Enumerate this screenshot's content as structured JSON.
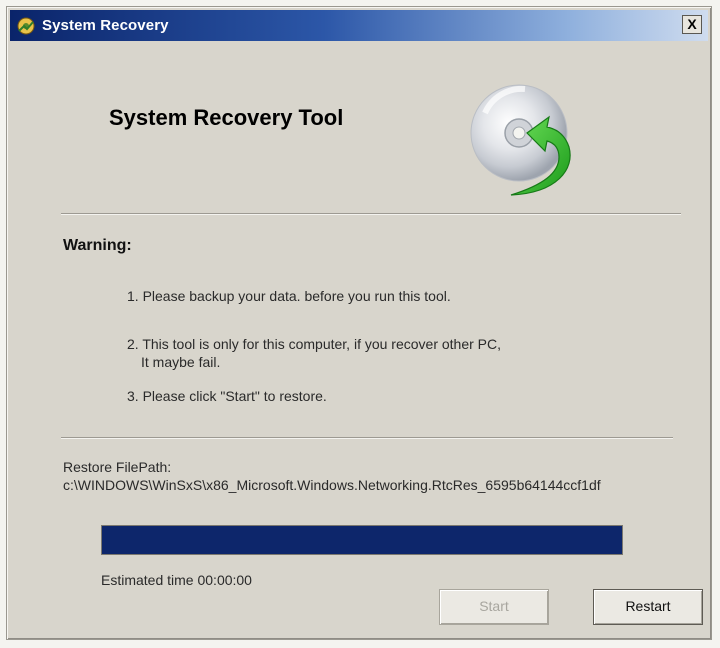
{
  "window": {
    "title": "System Recovery",
    "close_label": "X"
  },
  "header": {
    "title": "System Recovery Tool"
  },
  "warning": {
    "heading": "Warning:",
    "items": [
      {
        "line1": "1. Please backup your data. before you run this tool.",
        "line2": ""
      },
      {
        "line1": "2. This tool is only for this computer, if you recover other PC,",
        "line2": "It maybe fail."
      },
      {
        "line1": "3. Please click \"Start\" to restore.",
        "line2": ""
      }
    ]
  },
  "restore": {
    "label": "Restore FilePath:",
    "path": "c:\\WINDOWS\\WinSxS\\x86_Microsoft.Windows.Networking.RtcRes_6595b64144ccf1df"
  },
  "progress": {
    "fraction": 1.0,
    "fill_color": "#0d266b"
  },
  "status": {
    "estimated": "Estimated time 00:00:00"
  },
  "buttons": {
    "start_label": "Start",
    "start_enabled": false,
    "restart_label": "Restart"
  },
  "icons": {
    "app": "recovery-app-icon",
    "cd": "cd-disc-icon",
    "arrow": "green-curved-arrow-icon"
  }
}
